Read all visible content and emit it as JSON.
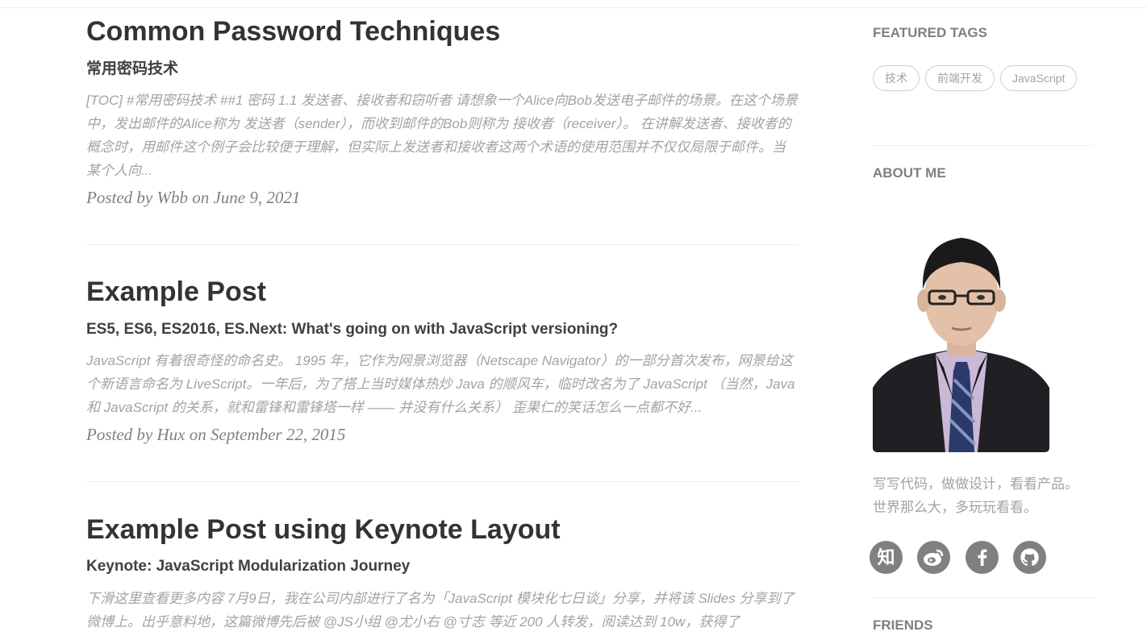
{
  "posts": [
    {
      "title": "Common Password Techniques",
      "subtitle": "常用密码技术",
      "excerpt": "[TOC] #常用密码技术 ##1 密码 1.1 发送者、接收者和窃听者 请想象一个Alice向Bob发送电子邮件的场景。在这个场景中，发出邮件的Alice称为 发送者（sender），而收到邮件的Bob则称为 接收者（receiver）。 在讲解发送者、接收者的概念时，用邮件这个例子会比较便于理解，但实际上发送者和接收者这两个术语的使用范围并不仅仅局限于邮件。当某个人向...",
      "meta": "Posted by Wbb on June 9, 2021"
    },
    {
      "title": "Example Post",
      "subtitle": "ES5, ES6, ES2016, ES.Next: What's going on with JavaScript versioning?",
      "excerpt": "JavaScript 有着很奇怪的命名史。 1995 年，它作为网景浏览器（Netscape Navigator）的一部分首次发布，网景给这个新语言命名为 LiveScript。一年后，为了搭上当时媒体热炒 Java 的顺风车，临时改名为了 JavaScript （当然，Java 和 JavaScript 的关系，就和雷锋和雷锋塔一样 —— 并没有什么关系） 歪果仁的笑话怎么一点都不好...",
      "meta": "Posted by Hux on September 22, 2015"
    },
    {
      "title": "Example Post using Keynote Layout",
      "subtitle": "Keynote: JavaScript Modularization Journey",
      "excerpt": "下滑这里查看更多内容 7月9日，我在公司内部进行了名为「JavaScript 模块化七日谈」分享，并将该 Slides 分享到了微博上。出乎意料地，这篇微博先后被 @JS小组 @尤小右 @寸志 等近 200 人转发，阅读达到 10w，获得了"
    }
  ],
  "sidebar": {
    "featured_tags_title": "FEATURED TAGS",
    "tags": [
      "技术",
      "前端开发",
      "JavaScript"
    ],
    "about_title": "ABOUT ME",
    "bio_line1": "写写代码，做做设计，看看产品。",
    "bio_line2": "世界那么大，多玩玩看看。",
    "social_icons": [
      "zhihu-icon",
      "weibo-icon",
      "facebook-icon",
      "github-icon"
    ],
    "zhihu_glyph": "知",
    "friends_title": "FRIENDS"
  },
  "colors": {
    "title": "#333333",
    "excerpt": "#a3a3a3",
    "meta": "#808080",
    "social_bg": "#808080"
  }
}
